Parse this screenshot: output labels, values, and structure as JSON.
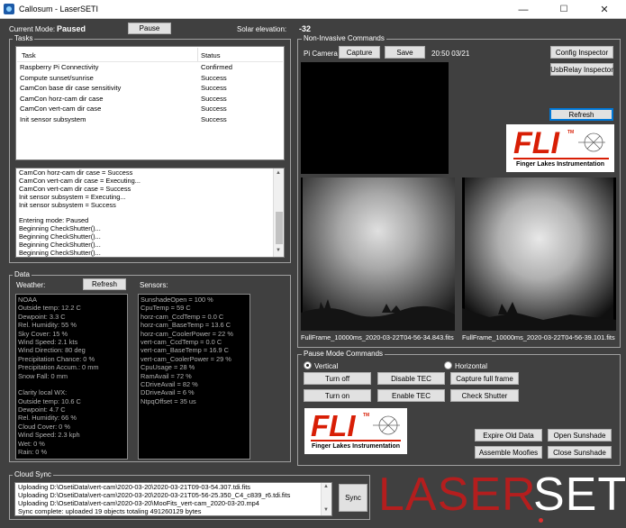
{
  "window": {
    "title": "Callosum - LaserSETI",
    "controls": [
      "—",
      "☐",
      "✕"
    ]
  },
  "header": {
    "mode_label": "Current Mode:",
    "mode_value": "Paused",
    "pause_button": "Pause",
    "solar_label": "Solar elevation:",
    "solar_value": "-32"
  },
  "tasks": {
    "group_title": "Tasks",
    "columns": [
      "Task",
      "Status"
    ],
    "rows": [
      {
        "task": "Raspberry Pi Connectivity",
        "status": "Confirmed"
      },
      {
        "task": "Compute sunset/sunrise",
        "status": "Success"
      },
      {
        "task": "CamCon base dir case sensitivity",
        "status": "Success"
      },
      {
        "task": "CamCon horz-cam dir case",
        "status": "Success"
      },
      {
        "task": "CamCon vert-cam dir case",
        "status": "Success"
      },
      {
        "task": "Init sensor subsystem",
        "status": "Success"
      }
    ],
    "log": [
      "CamCon horz-cam dir case = Success",
      "CamCon vert-cam dir case = Executing...",
      "CamCon vert-cam dir case = Success",
      "Init sensor subsystem = Executing...",
      "Init sensor subsystem = Success",
      "",
      "Entering mode: Paused",
      "Beginning CheckShutter()...",
      "Beginning CheckShutter()...",
      "Beginning CheckShutter()...",
      "Beginning CheckShutter()..."
    ]
  },
  "data_panel": {
    "group_title": "Data",
    "weather_label": "Weather:",
    "refresh_button": "Refresh",
    "sensors_label": "Sensors:",
    "weather": [
      "NOAA",
      "Outside temp: 12.2 C",
      "Dewpoint: 3.3 C",
      "Rel. Humidity: 55 %",
      "Sky Cover: 15 %",
      "Wind Speed: 2.1 kts",
      "Wind Direction: 80 deg",
      "Precipitation Chance: 0 %",
      "Precipitation Accum.: 0 mm",
      "Snow Fall: 0 mm",
      "",
      "Clarity local WX:",
      "Outside temp: 10.6 C",
      "Dewpoint: 4.7 C",
      "Rel. Humidity: 66 %",
      "Cloud Cover: 0 %",
      "Wind Speed: 2.3 kph",
      "Wet: 0 %",
      "Rain: 0 %"
    ],
    "sensors": [
      "SunshadeOpen = 100 %",
      "CpuTemp = 59 C",
      "horz-cam_CcdTemp = 0.0 C",
      "horz-cam_BaseTemp = 13.6 C",
      "horz-cam_CoolerPower = 22 %",
      "vert-cam_CcdTemp = 0.0 C",
      "vert-cam_BaseTemp = 16.9 C",
      "vert-cam_CoolerPower = 29 %",
      "CpuUsage = 28 %",
      "RamAvail = 72 %",
      "CDriveAvail = 82 %",
      "DDriveAvail = 6 %",
      "NtpqOffset = 35 us"
    ]
  },
  "noninvasive": {
    "group_title": "Non-Invasive Commands",
    "pi_camera_label": "Pi Camera",
    "capture_button": "Capture",
    "save_button": "Save",
    "timestamp": "20:50 03/21",
    "config_inspector_button": "Config Inspector",
    "usbrelay_inspector_button": "UsbRelay Inspector",
    "refresh_button": "Refresh",
    "image1_caption": "FullFrame_10000ms_2020-03-22T04-56-34.843.fits",
    "image2_caption": "FullFrame_10000ms_2020-03-22T04-56-39.101.fits"
  },
  "logo": {
    "fli": "FLI",
    "tm": "TM",
    "fli_subtitle": "Finger Lakes Instrumentation",
    "laser": "LASER",
    "seti": "SETI"
  },
  "pause_mode": {
    "group_title": "Pause Mode Commands",
    "vertical_label": "Vertical",
    "horizontal_label": "Horizontal",
    "turn_off_button": "Turn off",
    "disable_tec_button": "Disable TEC",
    "capture_full_frame_button": "Capture full frame",
    "turn_on_button": "Turn on",
    "enable_tec_button": "Enable TEC",
    "check_shutter_button": "Check Shutter",
    "expire_old_data_button": "Expire Old Data",
    "open_sunshade_button": "Open Sunshade",
    "assemble_moofies_button": "Assemble Moofies",
    "close_sunshade_button": "Close Sunshade"
  },
  "cloud_sync": {
    "group_title": "Cloud Sync",
    "log": [
      "Uploading D:\\OsetiData\\vert-cam\\2020-03-20\\2020-03-21T09-03-54.307.tdi.fits",
      "Uploading D:\\OsetiData\\vert-cam\\2020-03-20\\2020-03-21T05-56-25.350_C4_c839_r6.tdi.fits",
      "Uploading D:\\OsetiData\\vert-cam\\2020-03-20\\MooFits_vert-cam_2020-03-20.mp4",
      "Sync complete: uploaded 19 objects totaling 491260129 bytes"
    ],
    "sync_button": "Sync"
  },
  "colors": {
    "background": "#404040",
    "fli_red": "#d81e05",
    "laser_red": "#b41e1e"
  }
}
